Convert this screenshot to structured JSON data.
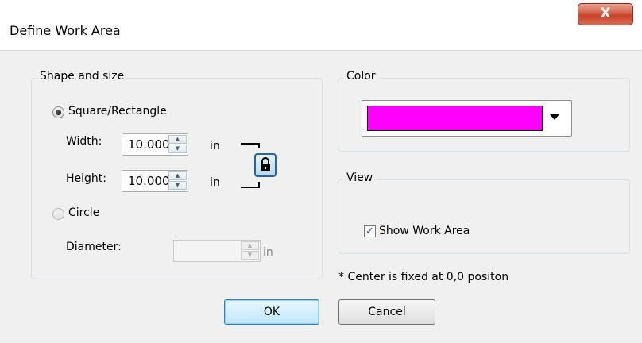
{
  "dialog": {
    "title": "Define Work Area",
    "close_label": "X"
  },
  "shape_size": {
    "legend": "Shape and size",
    "square_label": "Square/Rectangle",
    "width_label": "Width:",
    "width_value": "10.000",
    "height_label": "Height:",
    "height_value": "10.000",
    "unit": "in",
    "circle_label": "Circle",
    "diameter_label": "Diameter:",
    "diameter_value": "",
    "lock_icon": "lock-icon"
  },
  "color": {
    "legend": "Color",
    "selected_hex": "#ff00ff"
  },
  "view": {
    "legend": "View",
    "show_work_area_label": "Show Work Area",
    "show_work_area_checked": true
  },
  "note": "* Center is fixed at 0,0 positon",
  "buttons": {
    "ok": "OK",
    "cancel": "Cancel"
  }
}
